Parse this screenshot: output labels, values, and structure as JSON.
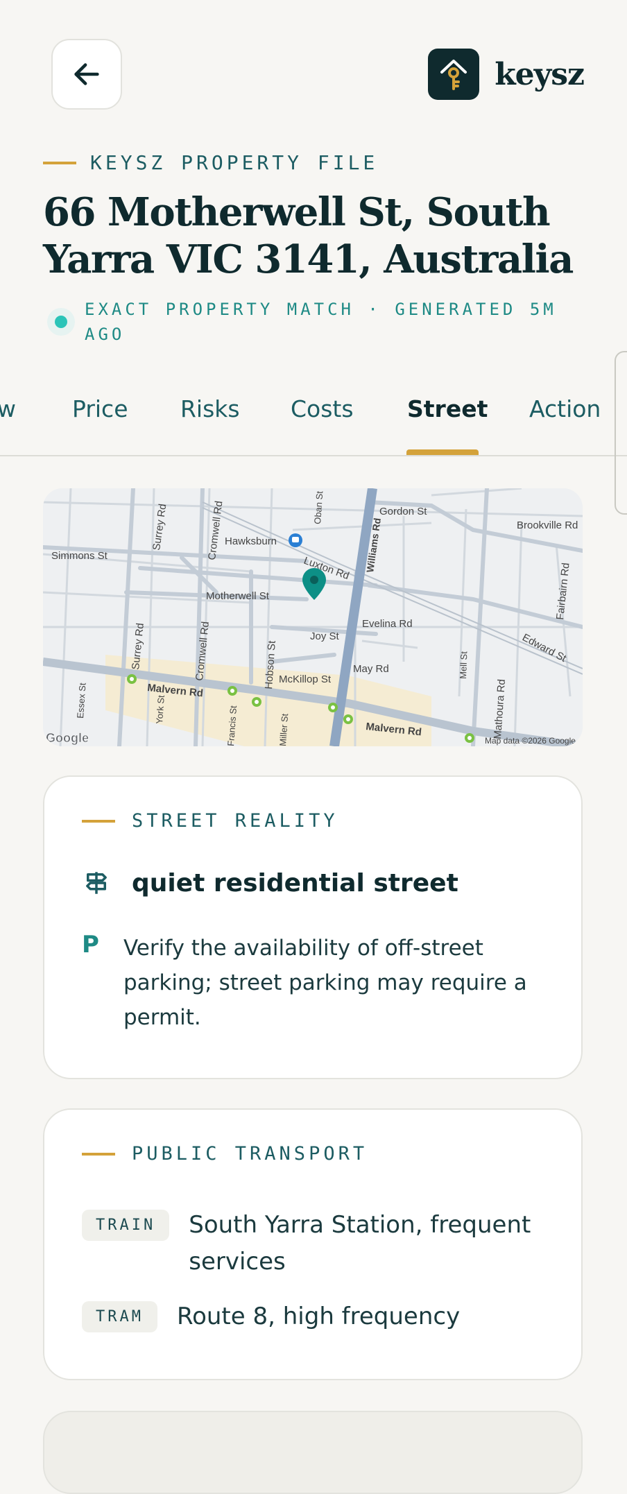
{
  "header": {
    "brand_name": "keysz"
  },
  "eyebrow": "KEYSZ PROPERTY FILE",
  "title": "66 Motherwell St, South Yarra VIC 3141, Australia",
  "match_text": "EXACT PROPERTY MATCH  ·  GENERATED 5M AGO",
  "tabs": [
    {
      "label": "w"
    },
    {
      "label": "Price"
    },
    {
      "label": "Risks"
    },
    {
      "label": "Costs"
    },
    {
      "label": "Street"
    },
    {
      "label": "Action"
    }
  ],
  "active_tab": "Street",
  "map": {
    "streets": {
      "surrey_top": "Surrey Rd",
      "cromwell_top": "Cromwell Rd",
      "oban": "Oban St",
      "williams": "Williams Rd",
      "gordon": "Gordon St",
      "brookville": "Brookville Rd",
      "hawksburn": "Hawksburn",
      "simmons": "Simmons St",
      "luxton": "Luxton Rd",
      "fairbairn": "Fairbairn Rd",
      "motherwell": "Motherwell St",
      "evelina": "Evelina Rd",
      "joy": "Joy St",
      "edward": "Edward St",
      "surrey_bottom": "Surrey Rd",
      "cromwell_bottom": "Cromwell Rd",
      "hobson": "Hobson St",
      "may": "May Rd",
      "mell": "Mell St",
      "mckillop": "McKillop St",
      "mathoura": "Mathoura Rd",
      "essex": "Essex St",
      "malvern_left": "Malvern Rd",
      "york": "York St",
      "francis": "Francis St",
      "miller": "Miller St",
      "malvern_right": "Malvern Rd"
    },
    "logo": "Google",
    "attribution": "Map data ©2026 Google"
  },
  "street_reality": {
    "heading": "STREET REALITY",
    "summary": "quiet residential street",
    "parking_icon": "P",
    "parking_note": "Verify the availability of off-street parking; street parking may require a permit."
  },
  "public_transport": {
    "heading": "PUBLIC TRANSPORT",
    "items": [
      {
        "badge": "TRAIN",
        "text": "South Yarra Station, frequent services"
      },
      {
        "badge": "TRAM",
        "text": "Route 8, high frequency"
      }
    ]
  },
  "colors": {
    "accent": "#d4a23a",
    "teal": "#1e8a85",
    "ink": "#0f2a2e",
    "background": "#f7f6f3"
  },
  "icons": {
    "back": "arrow-left-icon",
    "brand": "house-key-icon",
    "signpost": "signpost-icon",
    "pin": "map-pin-icon"
  }
}
